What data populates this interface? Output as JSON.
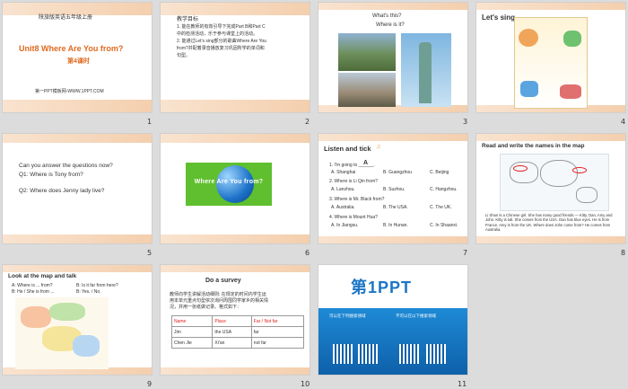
{
  "slides": [
    {
      "num": "1",
      "line1": "陕旅版英语五年级上册",
      "title": "Unit8 Where Are You from?",
      "subtitle": "第4课时",
      "footer": "第一PPT模板网-WWW.1PPT.COM"
    },
    {
      "num": "2",
      "heading": "教学目标",
      "lines": [
        "1. 能在教师的有效引导下完成Part B和Part C",
        "中的检测活动，乐于参与课堂上的活动。",
        "2. 能通过Let's sing部分的歌曲Where Are You",
        "from?并配着录音播放复习巩固所学的单词和",
        "句型。"
      ]
    },
    {
      "num": "3",
      "title1": "What's this?",
      "title2": "Where is it?"
    },
    {
      "num": "4",
      "title": "Let's sing"
    },
    {
      "num": "5",
      "lines": [
        "Can you answer the questions now?",
        "Q1: Where is Tony from?",
        "Q2: Where does Jenny lady live?"
      ]
    },
    {
      "num": "6",
      "globe_text": "Where Are You from?"
    },
    {
      "num": "7",
      "title": "Listen and tick",
      "q1": "1. I'm going to ______.",
      "q1a": "A. Shanghai",
      "q1b": "B. Guangzhou",
      "q1c": "C. Beijing",
      "q2": "2. Where is Li Qin from?",
      "q2a": "A. Lanzhou.",
      "q2b": "B. Suzhou.",
      "q2c": "C. Hangzhou.",
      "q3": "3. Where is Mr. Black from?",
      "q3a": "A. Australia.",
      "q3b": "B. The USA.",
      "q3c": "C. The UK.",
      "q4": "4. Where is Mount Hua?",
      "q4a": "A. In Jiangsu.",
      "q4b": "B. In Hunan.",
      "q4c": "C. In Shaanxi.",
      "answer": "A"
    },
    {
      "num": "8",
      "title": "Read and write the names  in the map",
      "p": "Li Shan is a Chinese girl. She has many good friends — Kitty, Dan, Amy and John. Kitty is tall. She comes from the USA. Dan has blue eyes. He is from France. Amy is from the UK. Where does John come from? He comes from Australia."
    },
    {
      "num": "9",
      "title": "Look at the map and talk",
      "a1": "A: Where is ... from?",
      "b1": "B: Is it far from here?",
      "a2": "B: He / She is from ...",
      "b2": "B: Yes. / No."
    },
    {
      "num": "10",
      "title": "Do a survey",
      "lines": [
        "教师向学生讲解活动细则: 在规定的时间内学生运",
        "用本单元重点句型依次询问周围同学家乡的相关情",
        "况，并用一张纸做记录。格式如下："
      ],
      "headers": [
        "Name",
        "Place",
        "Far / Not far"
      ],
      "rows": [
        [
          "Jim",
          "the USA",
          "far"
        ],
        [
          "Chen Jie",
          "Xi'an",
          "not far"
        ]
      ]
    },
    {
      "num": "11",
      "logo": "第1PPT",
      "sub1": "可以在下列搜索领域",
      "sub2": "不可以在以下搜索领域"
    }
  ]
}
